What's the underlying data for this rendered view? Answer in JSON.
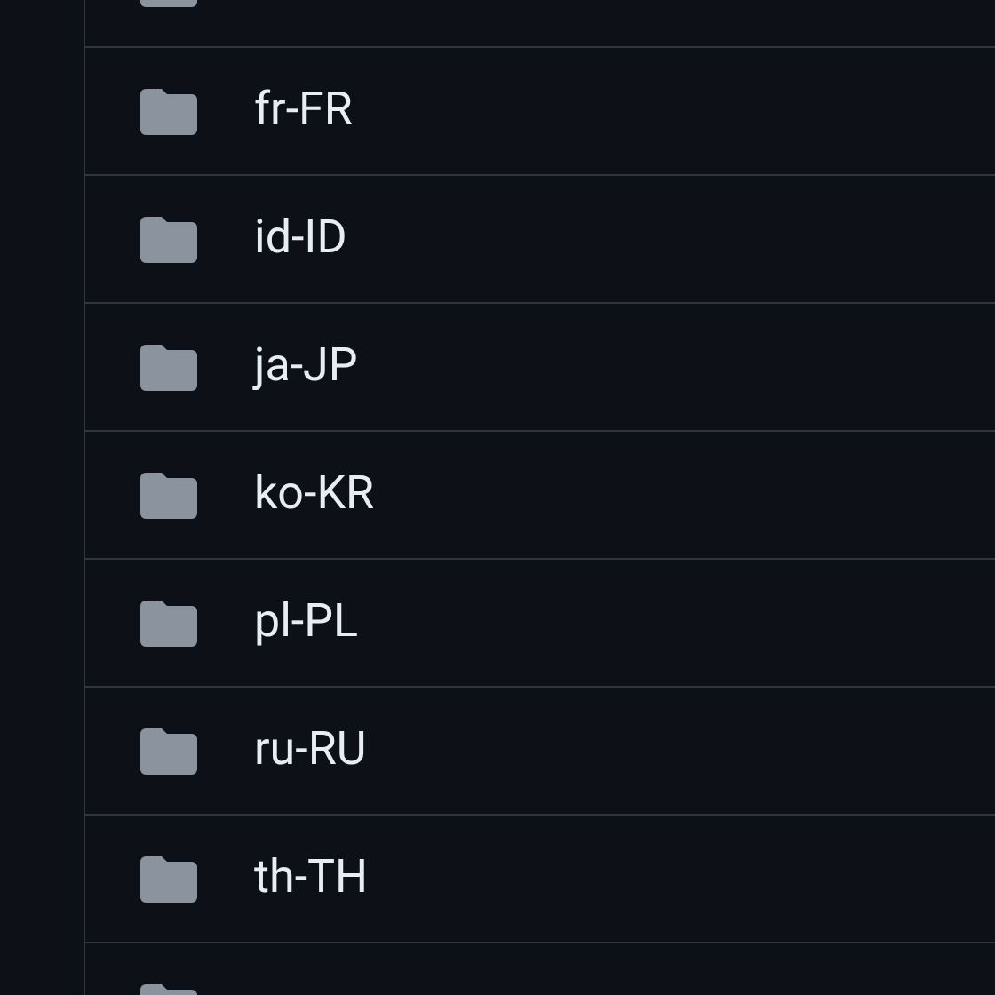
{
  "folders": [
    {
      "kind": "cut"
    },
    {
      "kind": "folder",
      "name": "fr-FR"
    },
    {
      "kind": "folder",
      "name": "id-ID"
    },
    {
      "kind": "folder",
      "name": "ja-JP"
    },
    {
      "kind": "folder",
      "name": "ko-KR"
    },
    {
      "kind": "folder",
      "name": "pl-PL"
    },
    {
      "kind": "folder",
      "name": "ru-RU"
    },
    {
      "kind": "folder",
      "name": "th-TH"
    },
    {
      "kind": "cut"
    }
  ]
}
